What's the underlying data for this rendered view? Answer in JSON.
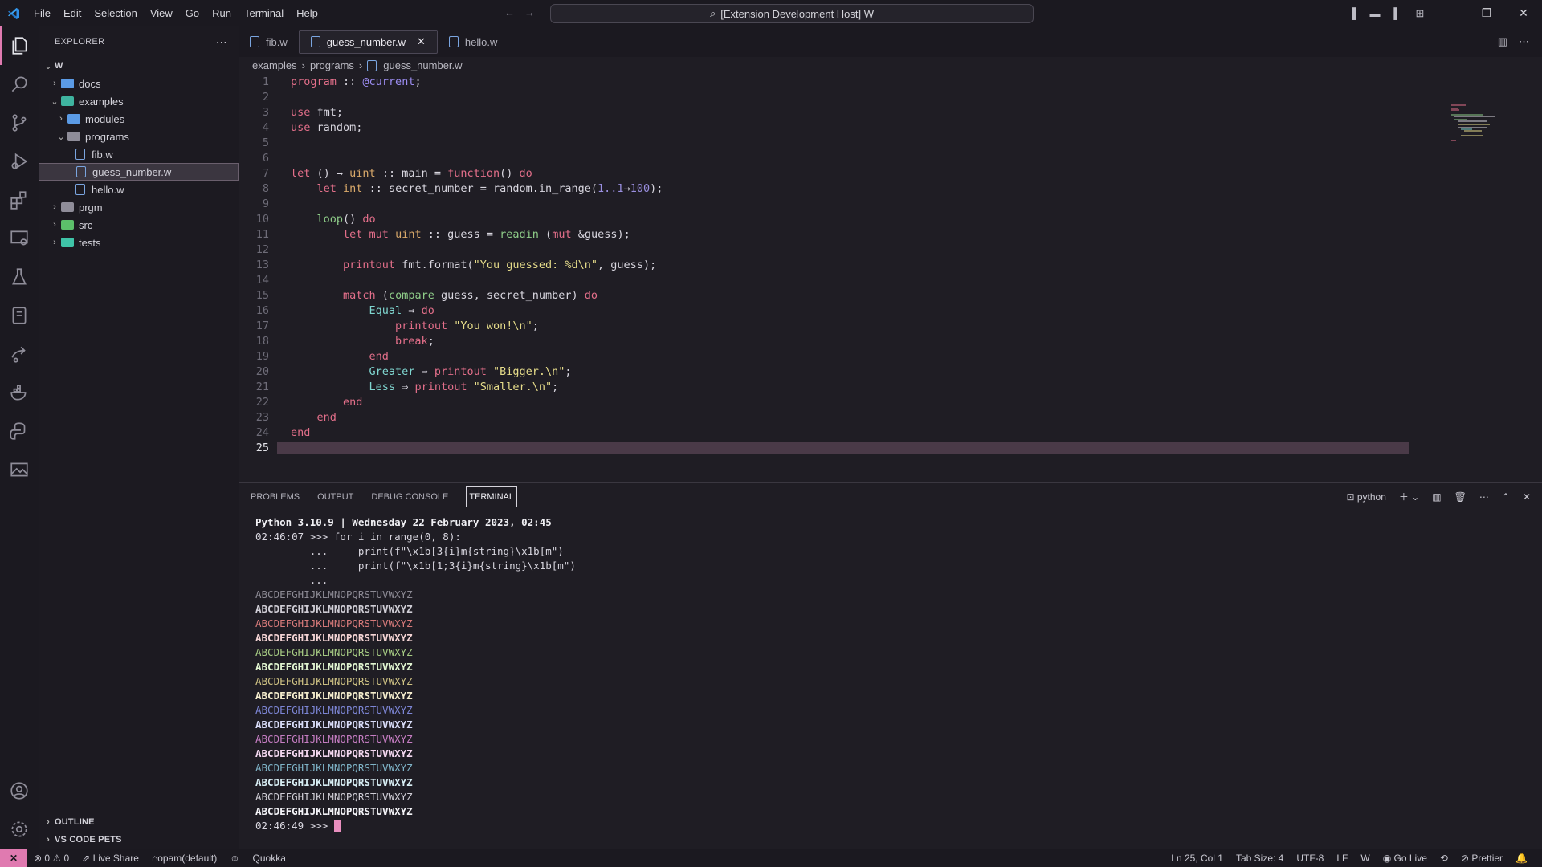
{
  "menu": [
    "File",
    "Edit",
    "Selection",
    "View",
    "Go",
    "Run",
    "Terminal",
    "Help"
  ],
  "command_center": "[Extension Development Host] W",
  "explorer": {
    "title": "EXPLORER",
    "root": "W",
    "items": [
      {
        "label": "docs",
        "indent": 1,
        "chev": ">",
        "color": "#5b9be6"
      },
      {
        "label": "examples",
        "indent": 1,
        "chev": "v",
        "color": "#3fb4a0"
      },
      {
        "label": "modules",
        "indent": 2,
        "chev": ">",
        "color": "#5b9be6"
      },
      {
        "label": "programs",
        "indent": 2,
        "chev": "v",
        "color": "#8f8d99"
      },
      {
        "label": "fib.w",
        "indent": 3,
        "file": true
      },
      {
        "label": "guess_number.w",
        "indent": 3,
        "file": true,
        "selected": true
      },
      {
        "label": "hello.w",
        "indent": 3,
        "file": true
      },
      {
        "label": "prgm",
        "indent": 1,
        "chev": ">",
        "color": "#8f8d99"
      },
      {
        "label": "src",
        "indent": 1,
        "chev": ">",
        "color": "#5cbf6a"
      },
      {
        "label": "tests",
        "indent": 1,
        "chev": ">",
        "color": "#3fc4a8"
      }
    ],
    "outline": "OUTLINE",
    "pets": "VS CODE PETS"
  },
  "tabs": [
    {
      "label": "fib.w",
      "active": false
    },
    {
      "label": "guess_number.w",
      "active": true
    },
    {
      "label": "hello.w",
      "active": false
    }
  ],
  "breadcrumb": [
    "examples",
    "programs",
    "guess_number.w"
  ],
  "code": [
    [
      [
        "kw",
        "program"
      ],
      [
        "pu",
        " :: "
      ],
      [
        "at",
        "@current"
      ],
      [
        "pu",
        ";"
      ]
    ],
    [],
    [
      [
        "kw",
        "use"
      ],
      [
        "pu",
        " fmt;"
      ]
    ],
    [
      [
        "kw",
        "use"
      ],
      [
        "pu",
        " random;"
      ]
    ],
    [],
    [],
    [
      [
        "kw",
        "let"
      ],
      [
        "pu",
        " () → "
      ],
      [
        "ty",
        "uint"
      ],
      [
        "pu",
        " :: main = "
      ],
      [
        "kw",
        "function"
      ],
      [
        "pu",
        "() "
      ],
      [
        "kw",
        "do"
      ]
    ],
    [
      [
        "pu",
        "    "
      ],
      [
        "kw",
        "let"
      ],
      [
        "pu",
        " "
      ],
      [
        "ty",
        "int"
      ],
      [
        "pu",
        " :: secret_number = random."
      ],
      [
        "pu",
        "in_range("
      ],
      [
        "nm",
        "1..1"
      ],
      [
        "pu",
        "→"
      ],
      [
        "nm",
        "100"
      ],
      [
        "pu",
        ");"
      ]
    ],
    [],
    [
      [
        "pu",
        "    "
      ],
      [
        "fn",
        "loop"
      ],
      [
        "pu",
        "() "
      ],
      [
        "kw",
        "do"
      ]
    ],
    [
      [
        "pu",
        "        "
      ],
      [
        "kw",
        "let mut"
      ],
      [
        "pu",
        " "
      ],
      [
        "ty",
        "uint"
      ],
      [
        "pu",
        " :: guess = "
      ],
      [
        "fn",
        "readin"
      ],
      [
        "pu",
        " ("
      ],
      [
        "kw",
        "mut"
      ],
      [
        "pu",
        " &guess);"
      ]
    ],
    [],
    [
      [
        "pu",
        "        "
      ],
      [
        "kw",
        "printout"
      ],
      [
        "pu",
        " fmt.format("
      ],
      [
        "st",
        "\"You guessed: %d\\n\""
      ],
      [
        "pu",
        ", guess);"
      ]
    ],
    [],
    [
      [
        "pu",
        "        "
      ],
      [
        "kw",
        "match"
      ],
      [
        "pu",
        " ("
      ],
      [
        "fn",
        "compare"
      ],
      [
        "pu",
        " guess, secret_number) "
      ],
      [
        "kw",
        "do"
      ]
    ],
    [
      [
        "pu",
        "            "
      ],
      [
        "vr",
        "Equal"
      ],
      [
        "pu",
        " ⇒ "
      ],
      [
        "kw",
        "do"
      ]
    ],
    [
      [
        "pu",
        "                "
      ],
      [
        "kw",
        "printout"
      ],
      [
        "pu",
        " "
      ],
      [
        "st",
        "\"You won!\\n\""
      ],
      [
        "pu",
        ";"
      ]
    ],
    [
      [
        "pu",
        "                "
      ],
      [
        "kw",
        "break"
      ],
      [
        "pu",
        ";"
      ]
    ],
    [
      [
        "pu",
        "            "
      ],
      [
        "kw",
        "end"
      ]
    ],
    [
      [
        "pu",
        "            "
      ],
      [
        "vr",
        "Greater"
      ],
      [
        "pu",
        " ⇒ "
      ],
      [
        "kw",
        "printout"
      ],
      [
        "pu",
        " "
      ],
      [
        "st",
        "\"Bigger.\\n\""
      ],
      [
        "pu",
        ";"
      ]
    ],
    [
      [
        "pu",
        "            "
      ],
      [
        "vr",
        "Less"
      ],
      [
        "pu",
        " ⇒ "
      ],
      [
        "kw",
        "printout"
      ],
      [
        "pu",
        " "
      ],
      [
        "st",
        "\"Smaller.\\n\""
      ],
      [
        "pu",
        ";"
      ]
    ],
    [
      [
        "pu",
        "        "
      ],
      [
        "kw",
        "end"
      ]
    ],
    [
      [
        "pu",
        "    "
      ],
      [
        "kw",
        "end"
      ]
    ],
    [
      [
        "kw",
        "end"
      ]
    ],
    []
  ],
  "current_line": 25,
  "panel": {
    "tabs": [
      "PROBLEMS",
      "OUTPUT",
      "DEBUG CONSOLE",
      "TERMINAL"
    ],
    "active": "TERMINAL",
    "shell": "python"
  },
  "terminal": {
    "header": "Python 3.10.9 | Wednesday 22 February 2023, 02:45",
    "lines": [
      "02:46:07 >>> for i in range(0, 8):",
      "         ...     print(f\"\\x1b[3{i}m{string}\\x1b[m\")",
      "         ...     print(f\"\\x1b[1;3{i}m{string}\\x1b[m\")",
      "         ..."
    ],
    "alphabet": "ABCDEFGHIJKLMNOPQRSTUVWXYZ",
    "colors": [
      "#8c8a94",
      "#d0ced6",
      "#d77a7a",
      "#f4d4d4",
      "#a7cc84",
      "#e0f4d0",
      "#cfc284",
      "#f4eccc",
      "#7d86d6",
      "#d8dcf8",
      "#c77ec4",
      "#f4d8f0",
      "#7fb4c8",
      "#d8eef4",
      "#d0ced6",
      "#f4f4f8"
    ],
    "bold": [
      false,
      true,
      false,
      true,
      false,
      true,
      false,
      true,
      false,
      true,
      false,
      true,
      false,
      true,
      false,
      true
    ],
    "prompt": "02:46:49 >>> "
  },
  "status": {
    "errors": "⊗ 0 ⚠ 0",
    "liveshare": "Live Share",
    "opam": "opam(default)",
    "quokka": "Quokka",
    "position": "Ln 25, Col 1",
    "tabsize": "Tab Size: 4",
    "encoding": "UTF-8",
    "eol": "LF",
    "lang": "W",
    "golive": "Go Live",
    "prettier": "Prettier"
  }
}
